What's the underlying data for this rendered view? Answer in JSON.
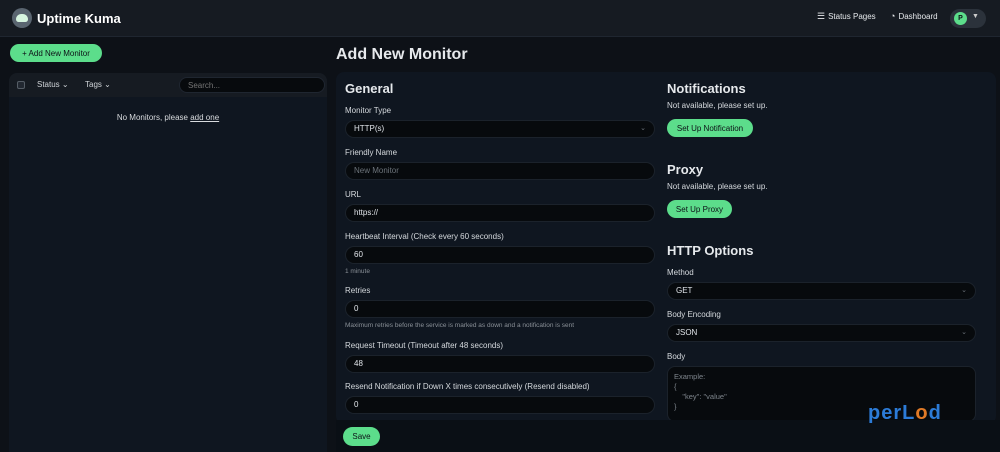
{
  "app": {
    "title": "Uptime Kuma"
  },
  "nav": {
    "status_pages": "Status Pages",
    "dashboard": "Dashboard",
    "avatar_initial": "P"
  },
  "sidebar": {
    "add_button": "+ Add New Monitor",
    "filters": {
      "status": "Status",
      "tags": "Tags"
    },
    "search_placeholder": "Search...",
    "empty_text": "No Monitors, please",
    "empty_link": "add one"
  },
  "page": {
    "title": "Add New Monitor"
  },
  "general": {
    "heading": "General",
    "monitor_type": {
      "label": "Monitor Type",
      "value": "HTTP(s)"
    },
    "friendly_name": {
      "label": "Friendly Name",
      "placeholder": "New Monitor"
    },
    "url": {
      "label": "URL",
      "value": "https://"
    },
    "heartbeat": {
      "label": "Heartbeat Interval (Check every 60 seconds)",
      "value": "60",
      "hint": "1 minute"
    },
    "retries": {
      "label": "Retries",
      "value": "0",
      "hint": "Maximum retries before the service is marked as down and a notification is sent"
    },
    "timeout": {
      "label": "Request Timeout (Timeout after 48 seconds)",
      "value": "48"
    },
    "resend": {
      "label": "Resend Notification if Down X times consecutively (Resend disabled)",
      "value": "0"
    }
  },
  "notifications": {
    "heading": "Notifications",
    "text": "Not available, please set up.",
    "button": "Set Up Notification"
  },
  "proxy": {
    "heading": "Proxy",
    "text": "Not available, please set up.",
    "button": "Set Up Proxy"
  },
  "http_options": {
    "heading": "HTTP Options",
    "method": {
      "label": "Method",
      "value": "GET"
    },
    "body_encoding": {
      "label": "Body Encoding",
      "value": "JSON"
    },
    "body": {
      "label": "Body",
      "placeholder": "Example:\n{\n    \"key\": \"value\"\n}"
    }
  },
  "save_button": "Save",
  "watermark": {
    "text_a": "perL",
    "text_o": "o",
    "text_b": "d"
  },
  "colors": {
    "accent": "#5cdd8b",
    "background": "#0d1117",
    "panel": "#0f1620"
  }
}
